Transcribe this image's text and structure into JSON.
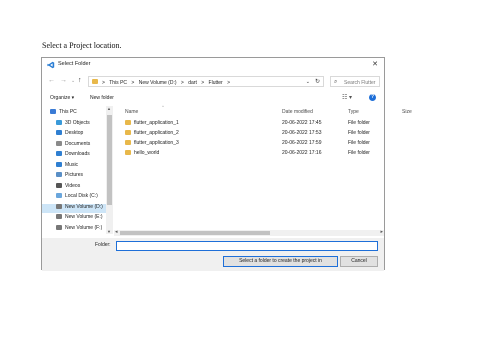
{
  "caption": "Select a Project location.",
  "dialog": {
    "title": "Select Folder",
    "close_glyph": "✕",
    "nav": {
      "back": "←",
      "forward": "→",
      "down": "⌄",
      "up": "↑"
    },
    "address": {
      "crumbs": [
        "This PC",
        "New Volume (D:)",
        "dart",
        "Flutter"
      ],
      "separator": ">",
      "dropdown_glyph": "⌄",
      "refresh_glyph": "↻"
    },
    "search": {
      "placeholder": "Search Flutter",
      "icon_glyph": "⌕"
    },
    "toolbar": {
      "organize": "Organize ▾",
      "new_folder": "New folder",
      "view_glyph": "☷ ▾",
      "help_glyph": "?"
    },
    "sidebar": {
      "items": [
        {
          "label": "This PC",
          "icon": "pc-icon",
          "color": "#3a7bd5"
        },
        {
          "label": "3D Objects",
          "icon": "cube-icon",
          "color": "#3a9ad9"
        },
        {
          "label": "Desktop",
          "icon": "desktop-icon",
          "color": "#2f7fd1"
        },
        {
          "label": "Documents",
          "icon": "document-icon",
          "color": "#8a8a8a"
        },
        {
          "label": "Downloads",
          "icon": "download-icon",
          "color": "#2f7fd1"
        },
        {
          "label": "Music",
          "icon": "music-icon",
          "color": "#2f7fd1"
        },
        {
          "label": "Pictures",
          "icon": "pictures-icon",
          "color": "#5a8fc6"
        },
        {
          "label": "Videos",
          "icon": "video-icon",
          "color": "#555555"
        },
        {
          "label": "Local Disk (C:)",
          "icon": "drive-icon",
          "color": "#6aa6dc"
        },
        {
          "label": "New Volume (D:)",
          "icon": "drive-icon",
          "color": "#777777"
        },
        {
          "label": "New Volume (E:)",
          "icon": "drive-icon",
          "color": "#777777"
        },
        {
          "label": "New Volume (F:)",
          "icon": "drive-icon",
          "color": "#777777"
        }
      ],
      "selected_index": 9
    },
    "files": {
      "columns": {
        "name": "Name",
        "date": "Date modified",
        "type": "Type",
        "size": "Size"
      },
      "rows": [
        {
          "name": "flutter_application_1",
          "date": "20-06-2022 17:45",
          "type": "File folder"
        },
        {
          "name": "flutter_application_2",
          "date": "20-06-2022 17:53",
          "type": "File folder"
        },
        {
          "name": "flutter_application_3",
          "date": "20-06-2022 17:59",
          "type": "File folder"
        },
        {
          "name": "hello_world",
          "date": "20-06-2022 17:16",
          "type": "File folder"
        }
      ]
    },
    "folder_label": "Folder:",
    "folder_value": "",
    "select_button": "Select a folder to create the project in",
    "cancel_button": "Cancel"
  },
  "colors": {
    "accent": "#1e6fd8",
    "folder": "#e8b84a",
    "selection": "#cde5f7"
  }
}
